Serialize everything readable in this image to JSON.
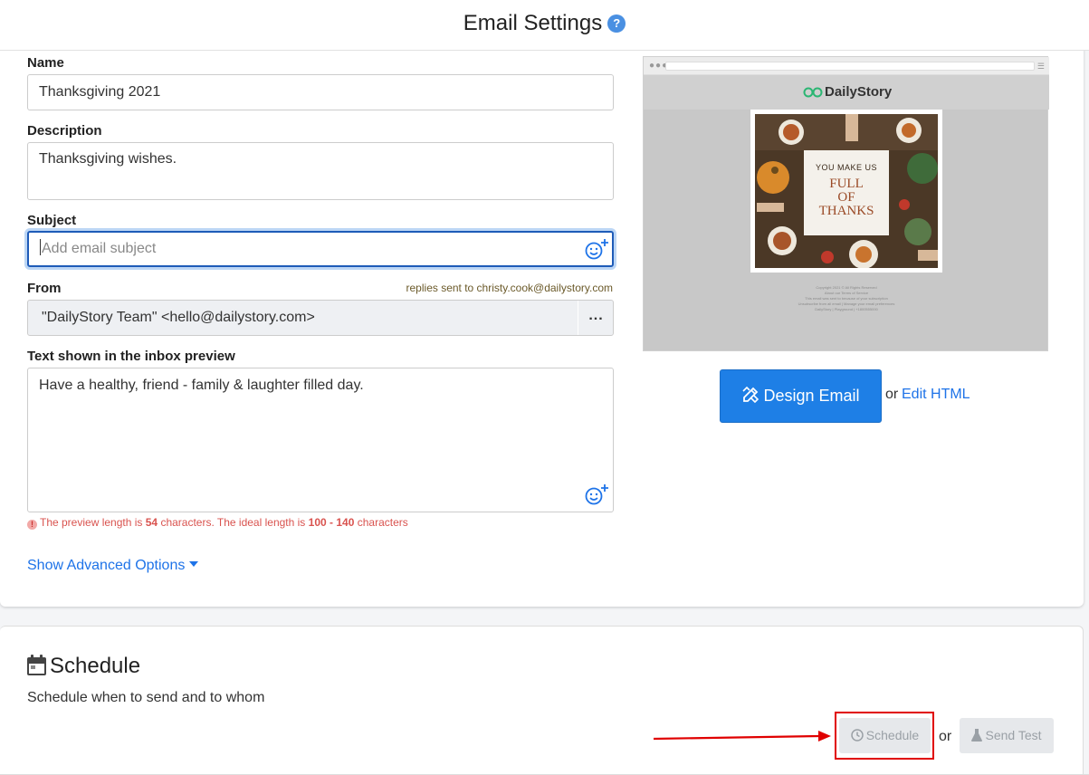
{
  "header": {
    "title": "Email Settings",
    "help": "?"
  },
  "form": {
    "name_label": "Name",
    "name_value": "Thanksgiving 2021",
    "description_label": "Description",
    "description_value": "Thanksgiving wishes.",
    "subject_label": "Subject",
    "subject_placeholder": "Add email subject",
    "from_label": "From",
    "from_replies": "replies sent to christy.cook@dailystory.com",
    "from_value": "\"DailyStory Team\" <hello@dailystory.com>",
    "from_more": "...",
    "preview_label": "Text shown in the inbox preview",
    "preview_value": "Have a healthy, friend - family & laughter filled day.",
    "warning": {
      "prefix": "The preview length is",
      "length": "54",
      "middle": "characters. The ideal length is",
      "range": "100 - 140",
      "suffix": "characters"
    },
    "advanced_link": "Show Advanced Options"
  },
  "preview": {
    "logo": "DailyStory",
    "card_line1": "YOU MAKE US",
    "card_line2": "FULL",
    "card_line3": "OF",
    "card_line4": "THANKS",
    "footer_lines": [
      "Copyright 2021 © All Rights Reserved",
      "About our Terms of Service",
      "This email was sent to because of your subscription",
      "Unsubscribe from all email | Manage your email preferences",
      "DailyStory | Playground | +1800555000"
    ]
  },
  "actions": {
    "design_email": "Design Email",
    "or": "or",
    "edit_html": "Edit HTML"
  },
  "schedule": {
    "title": "Schedule",
    "description": "Schedule when to send and to whom",
    "schedule_button": "Schedule",
    "or": "or",
    "send_test_button": "Send Test"
  },
  "colors": {
    "accent": "#1e7fe6",
    "link": "#1e73e8",
    "warning": "#d9534f",
    "highlight": "#e00000"
  }
}
